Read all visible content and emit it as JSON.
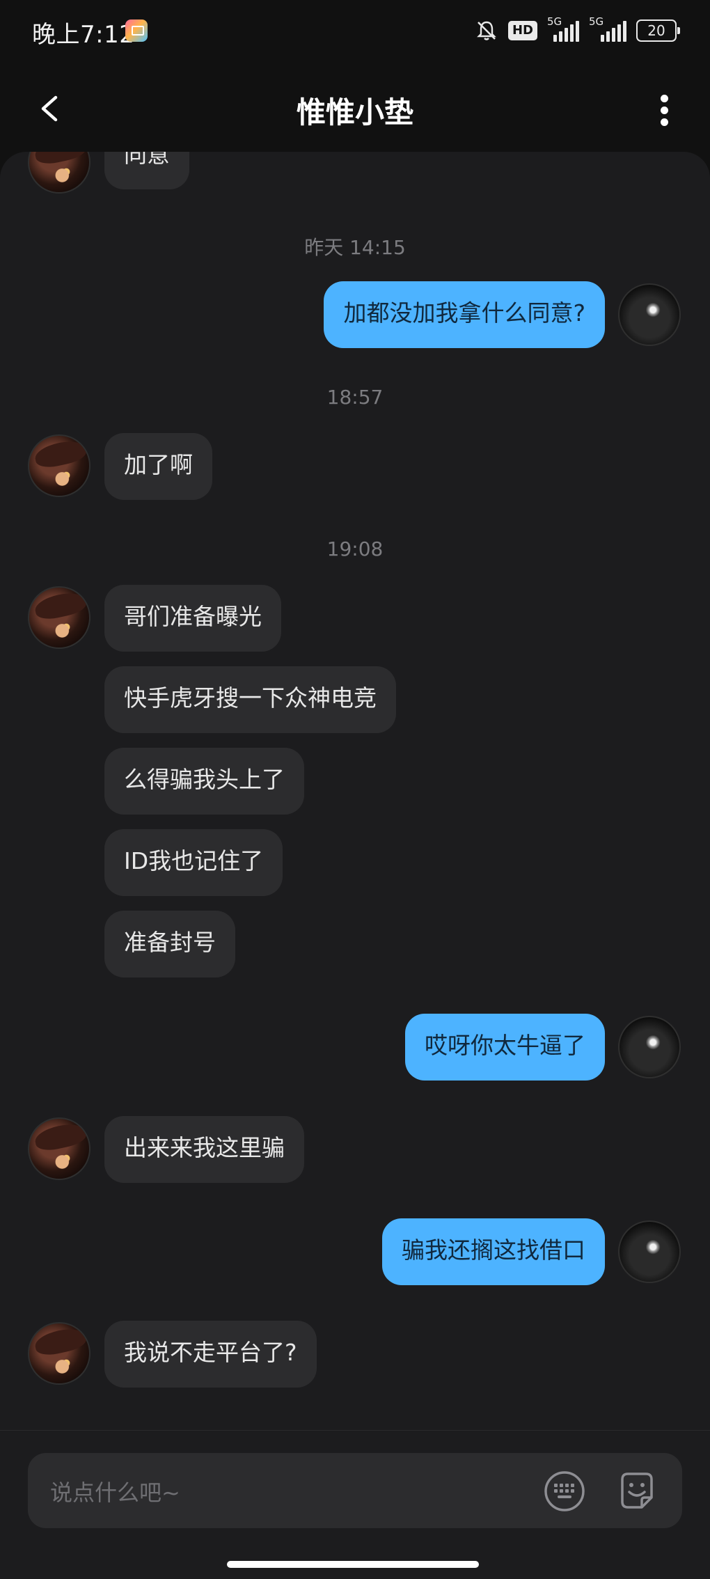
{
  "status_bar": {
    "time": "晚上7:12",
    "hd_label": "HD",
    "network_1": "5G",
    "network_2": "5G",
    "battery": "20"
  },
  "header": {
    "title": "惟惟小垫"
  },
  "timestamps": [
    "昨天 14:15",
    "18:57",
    "19:08"
  ],
  "messages": [
    {
      "side": "other",
      "text": "同意"
    },
    {
      "side": "self",
      "text": "加都没加我拿什么同意?"
    },
    {
      "side": "other",
      "text": "加了啊"
    },
    {
      "side": "other",
      "text": "哥们准备曝光"
    },
    {
      "side": "other",
      "text": "快手虎牙搜一下众神电竞"
    },
    {
      "side": "other",
      "text": "么得骗我头上了"
    },
    {
      "side": "other",
      "text": "ID我也记住了"
    },
    {
      "side": "other",
      "text": "准备封号"
    },
    {
      "side": "self",
      "text": "哎呀你太牛逼了"
    },
    {
      "side": "other",
      "text": "出来来我这里骗"
    },
    {
      "side": "self",
      "text": "骗我还搁这找借口"
    },
    {
      "side": "other",
      "text": "我说不走平台了?"
    }
  ],
  "input": {
    "placeholder": "说点什么吧~"
  },
  "icons": {
    "back": "chevron-left-icon",
    "more": "more-vertical-icon",
    "keyboard": "keyboard-icon",
    "sticker": "sticker-icon",
    "mute": "bell-off-icon"
  },
  "colors": {
    "background": "#111111",
    "chat_panel": "#1c1c1e",
    "bubble_other": "#2c2c2e",
    "bubble_self": "#4db3ff"
  }
}
